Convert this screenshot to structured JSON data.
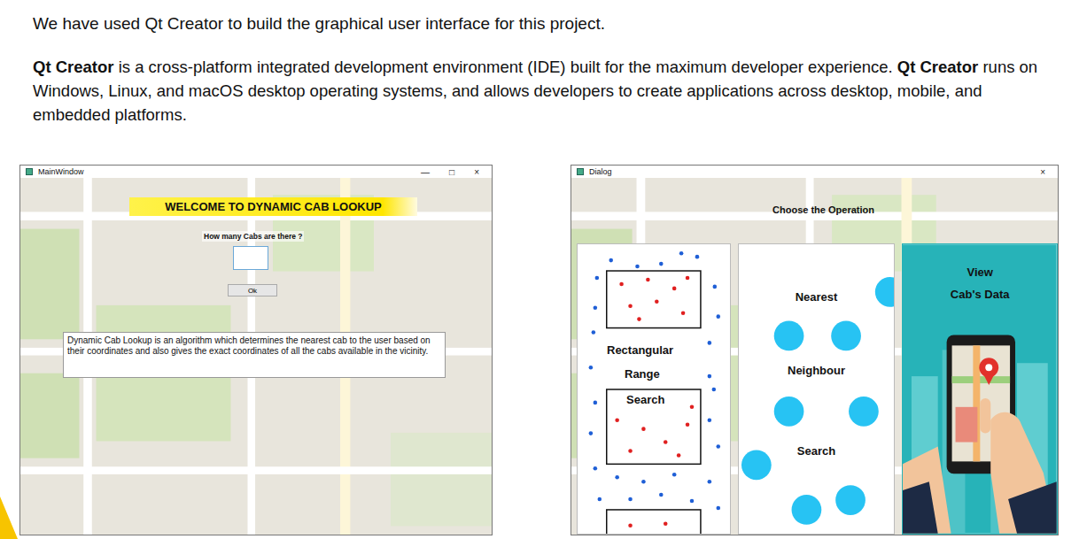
{
  "slide": {
    "intro": "We have used Qt Creator to build the graphical user interface for this project.",
    "paragraph": [
      {
        "text": "Qt Creator",
        "bold": true
      },
      {
        "text": " is a cross-platform integrated development environment (IDE) built for the maximum developer experience. ",
        "bold": false
      },
      {
        "text": "Qt Creator",
        "bold": true
      },
      {
        "text": " runs on Windows, Linux, and macOS desktop operating systems, and allows developers to create applications across desktop, mobile, and embedded platforms.",
        "bold": false
      }
    ]
  },
  "main_window": {
    "title": "MainWindow",
    "controls": [
      "—",
      "□",
      "×"
    ],
    "banner": "WELCOME TO DYNAMIC CAB LOOKUP",
    "prompt": "How many Cabs are there ?",
    "cab_count": {
      "value": ""
    },
    "ok_button": "Ok",
    "description": "Dynamic Cab Lookup is an algorithm which determines the nearest cab to the user based on their coordinates and also gives the exact coordinates of all the cabs available in the vicinity."
  },
  "dialog": {
    "title": "Dialog",
    "controls": [
      "×"
    ],
    "heading": "Choose the Operation",
    "operations": [
      {
        "kind": "range",
        "lines": [
          "Rectangular",
          "Range",
          "Search"
        ]
      },
      {
        "kind": "nearest",
        "lines": [
          "Nearest",
          "Neighbour",
          "Search"
        ]
      },
      {
        "kind": "view",
        "lines": [
          "View",
          "Cab's Data"
        ]
      }
    ]
  }
}
